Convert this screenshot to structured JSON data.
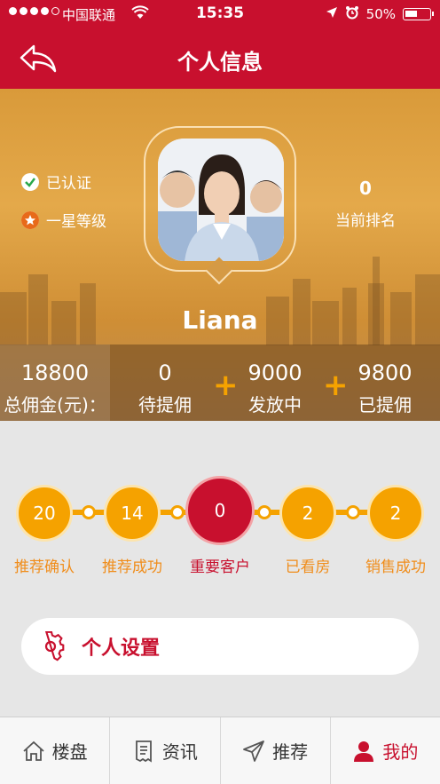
{
  "status_bar": {
    "carrier": "中国联通",
    "time": "15:35",
    "battery": "50%"
  },
  "nav": {
    "title": "个人信息"
  },
  "profile": {
    "verified_label": "已认证",
    "level_label": "一星等级",
    "rank_value": "0",
    "rank_label": "当前排名",
    "username": "Liana"
  },
  "stats": [
    {
      "value": "18800",
      "label": "总佣金(元)："
    },
    {
      "value": "0",
      "label": "待提佣"
    },
    {
      "value": "9000",
      "label": "发放中"
    },
    {
      "value": "9800",
      "label": "已提佣"
    }
  ],
  "steps": [
    {
      "value": "20",
      "label": "推荐确认"
    },
    {
      "value": "14",
      "label": "推荐成功"
    },
    {
      "value": "0",
      "label": "重要客户"
    },
    {
      "value": "2",
      "label": "已看房"
    },
    {
      "value": "2",
      "label": "销售成功"
    }
  ],
  "settings": {
    "label": "个人设置"
  },
  "tabs": [
    {
      "label": "楼盘",
      "icon": "home-icon"
    },
    {
      "label": "资讯",
      "icon": "news-icon"
    },
    {
      "label": "推荐",
      "icon": "send-icon"
    },
    {
      "label": "我的",
      "icon": "user-icon"
    }
  ],
  "colors": {
    "brand_red": "#c8102e",
    "accent_orange": "#f5a200",
    "step_label": "#f08d1b"
  }
}
